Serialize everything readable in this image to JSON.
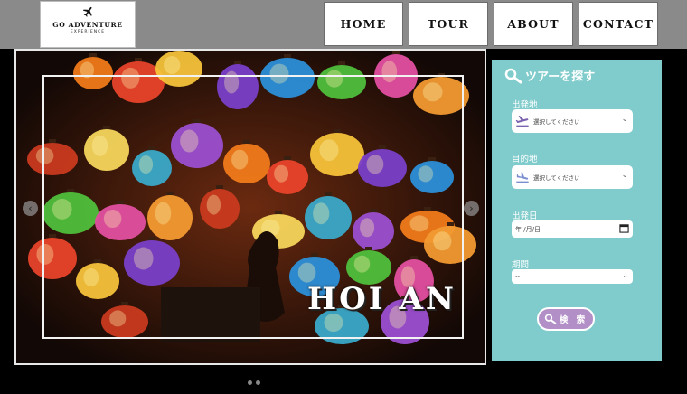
{
  "logo": {
    "line1": "GO ADVENTURE",
    "line2": "EXPERIENCE"
  },
  "nav": [
    {
      "label": "HOME"
    },
    {
      "label": "TOUR"
    },
    {
      "label": "ABOUT"
    },
    {
      "label": "CONTACT"
    }
  ],
  "slider": {
    "title": "HOI AN",
    "prev_icon": "chevron-left-icon",
    "next_icon": "chevron-right-icon",
    "slide_count": 2
  },
  "search": {
    "title": "ツアーを探す",
    "departure": {
      "label": "出発地",
      "placeholder": "選択してください",
      "icon": "airplane-takeoff-icon"
    },
    "destination": {
      "label": "目的地",
      "placeholder": "選択してください",
      "icon": "airplane-landing-icon"
    },
    "date": {
      "label": "出発日",
      "value": "年 /月/日"
    },
    "duration": {
      "label": "期間",
      "value": "--"
    },
    "button_label": "検 索"
  },
  "colors": {
    "header": "#8a8a8a",
    "panel": "#80cbcb",
    "button": "#b28fc7"
  }
}
